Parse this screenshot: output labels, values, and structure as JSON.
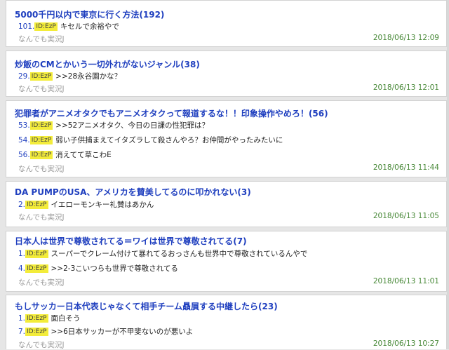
{
  "threads": [
    {
      "title": "5000千円以内で東京に行く方法(192)",
      "replies": [
        {
          "num": "101.",
          "id": "ID:EzP",
          "text": "キセルで余裕やで"
        }
      ],
      "board": "なんでも実況J",
      "timestamp": "2018/06/13 12:09"
    },
    {
      "title": "炒飯のCMとかいう一切外れがないジャンル(38)",
      "replies": [
        {
          "num": "29.",
          "id": "ID:EzP",
          "text": ">>28永谷園かな？"
        }
      ],
      "board": "なんでも実況J",
      "timestamp": "2018/06/13 12:01"
    },
    {
      "title": "犯罪者がアニメオタクでもアニメオタクって報道するな！！印象操作やめろ！(56)",
      "replies": [
        {
          "num": "53.",
          "id": "ID:EzP",
          "text": ">>52アニメオタク、今日の日課の性犯罪は？"
        },
        {
          "num": "54.",
          "id": "ID:EzP",
          "text": "弱い子供捕まえてイタズラして殺さんやろ？お仲間がやったみたいに"
        },
        {
          "num": "56.",
          "id": "ID:EzP",
          "text": "消えてて草こわE"
        }
      ],
      "board": "なんでも実況J",
      "timestamp": "2018/06/13 11:44"
    },
    {
      "title": "DA PUMPのUSA、アメリカを賛美してるのに叩かれない(3)",
      "replies": [
        {
          "num": "2.",
          "id": "ID:EzP",
          "text": "イエローモンキー礼賛はあかん"
        }
      ],
      "board": "なんでも実況J",
      "timestamp": "2018/06/13 11:05"
    },
    {
      "title": "日本人は世界で尊敬されてる＝ワイは世界で尊敬されてる(7)",
      "replies": [
        {
          "num": "1.",
          "id": "ID:EzP",
          "text": "スーパーでクレーム付けて暴れてるおっさんも世界中で尊敬されているんやで"
        },
        {
          "num": "4.",
          "id": "ID:EzP",
          "text": ">>2-3こいつらも世界で尊敬されてる"
        }
      ],
      "board": "なんでも実況J",
      "timestamp": "2018/06/13 11:01"
    },
    {
      "title": "もしサッカー日本代表じゃなくて相手チーム贔屓する中継したら(23)",
      "replies": [
        {
          "num": "1.",
          "id": "ID:EzP",
          "text": "面白そう"
        },
        {
          "num": "7.",
          "id": "ID:EzP",
          "text": ">>6日本サッカーが不甲斐ないのが悪いよ"
        }
      ],
      "board": "なんでも実況J",
      "timestamp": "2018/06/13 10:27"
    }
  ]
}
